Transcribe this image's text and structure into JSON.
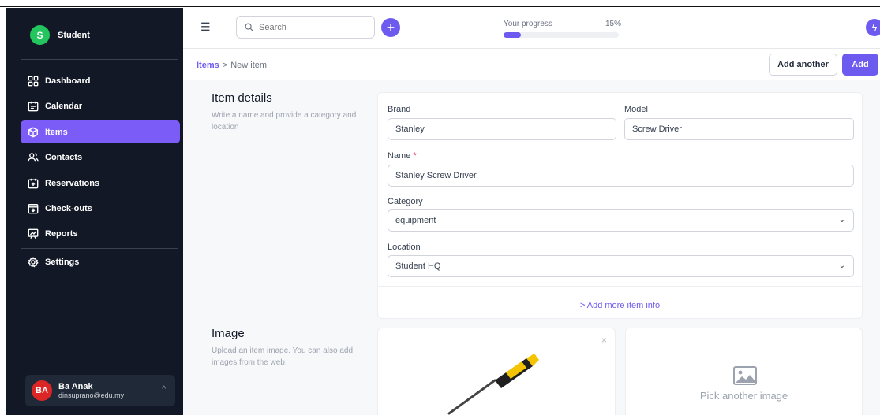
{
  "sidebar": {
    "brand": {
      "initial": "S",
      "name": "Student"
    },
    "items": [
      {
        "label": "Dashboard",
        "icon": "dashboard-icon"
      },
      {
        "label": "Calendar",
        "icon": "calendar-icon"
      },
      {
        "label": "Items",
        "icon": "cube-icon",
        "active": true
      },
      {
        "label": "Contacts",
        "icon": "contacts-icon"
      },
      {
        "label": "Reservations",
        "icon": "reservations-icon"
      },
      {
        "label": "Check-outs",
        "icon": "checkout-icon"
      },
      {
        "label": "Reports",
        "icon": "reports-icon"
      },
      {
        "label": "Settings",
        "icon": "gear-icon"
      }
    ],
    "user": {
      "initials": "BA",
      "name": "Ba Anak",
      "email": "dinsuprano@edu.my"
    }
  },
  "header": {
    "search_placeholder": "Search",
    "progress": {
      "label": "Your progress",
      "percent_text": "15%",
      "value": 0.15
    }
  },
  "breadcrumb": {
    "root": "Items",
    "separator": ">",
    "current": "New item"
  },
  "actions": {
    "add_another": "Add another",
    "add": "Add"
  },
  "item_details": {
    "title": "Item details",
    "description": "Write a name and provide a category and location",
    "brand": {
      "label": "Brand",
      "value": "Stanley"
    },
    "model": {
      "label": "Model",
      "value": "Screw Driver"
    },
    "name": {
      "label": "Name",
      "required_mark": "*",
      "value": "Stanley Screw Driver"
    },
    "category": {
      "label": "Category",
      "value": "equipment"
    },
    "location": {
      "label": "Location",
      "value": "Student HQ"
    },
    "more_info": "> Add more item info"
  },
  "image_section": {
    "title": "Image",
    "description": "Upload an item image. You can also add images from the web.",
    "pick_another": "Pick another image"
  },
  "colors": {
    "accent": "#6d5bf0",
    "sidebar_bg": "#121826",
    "active_nav": "#7c5cf6",
    "brand_avatar": "#22c55e",
    "user_avatar": "#dc2626"
  }
}
